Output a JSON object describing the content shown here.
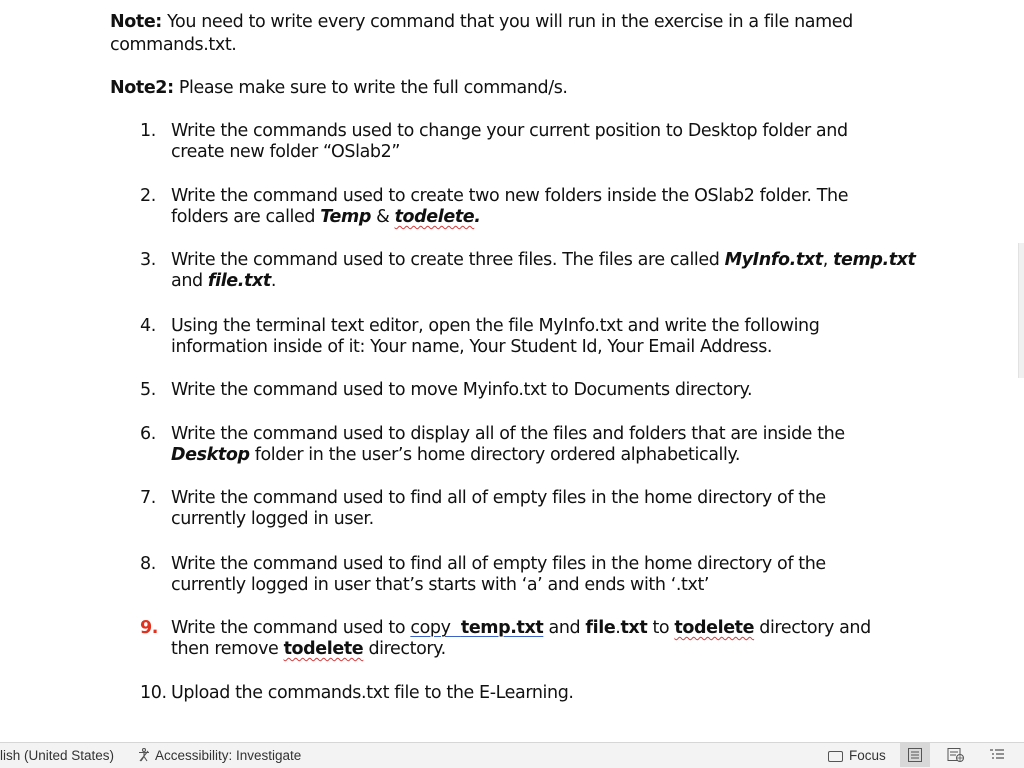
{
  "document": {
    "note1": {
      "label": "Note:",
      "text1": " You need to write every command that you will run in the exercise in a file named",
      "text2": "commands.txt."
    },
    "note2": {
      "label": "Note2:",
      "text": " Please make sure to write the full command/s."
    },
    "items": [
      {
        "num": "1.",
        "line1": "Write the commands used to change your current position to Desktop folder and",
        "line2": "create new folder “OSlab2”"
      },
      {
        "num": "2.",
        "line1": "Write the command used to create two new folders inside the OSlab2 folder. The",
        "l2a": "folders are called ",
        "l2b": "Temp",
        "l2c": " & ",
        "l2d": "todelete",
        "l2e": "."
      },
      {
        "num": "3.",
        "l1a": "Write the command used to create three files. The files are called ",
        "l1b": "MyInfo.txt",
        "l1c": ", ",
        "l1d": "temp.txt",
        "l2a": "and ",
        "l2b": "file.txt",
        "l2c": "."
      },
      {
        "num": "4.",
        "line1": "Using the terminal text editor, open the file MyInfo.txt and write the following",
        "line2": "information inside of it: Your name, Your Student Id, Your Email Address."
      },
      {
        "num": "5.",
        "line1": "Write the command used to move Myinfo.txt to Documents directory."
      },
      {
        "num": "6.",
        "line1": "Write the command used to display all of the files and folders that are inside the",
        "l2a": "Desktop",
        "l2b": " folder in the user’s home directory ordered alphabetically."
      },
      {
        "num": "7.",
        "line1": "Write the command used to find all of empty files in the home directory of the",
        "line2": "currently logged in user."
      },
      {
        "num": "8.",
        "line1": "Write the command used to find all of empty files in the home directory of the",
        "line2": "currently logged in user that’s starts with ‘a’ and ends with ‘.txt’"
      },
      {
        "num": "9.",
        "l1a": "Write the command used to ",
        "l1b": "copy  ",
        "l1c": "temp.txt",
        "l1d": " and ",
        "l1e": "file",
        "l1f": ".",
        "l1g": "txt",
        "l1h": " to ",
        "l1i": "todelete",
        "l1j": " directory and",
        "l2a": "then remove ",
        "l2b": "todelete",
        "l2c": " directory."
      },
      {
        "num": "10.",
        "line1": "Upload the commands.txt file to the E-Learning."
      }
    ]
  },
  "status_bar": {
    "language": "lish (United States)",
    "accessibility": "Accessibility: Investigate",
    "focus": "Focus"
  },
  "colors": {
    "red_number": "#e0321f",
    "spell_underline": "#d23b3b",
    "grammar_underline": "#3d62c7"
  }
}
